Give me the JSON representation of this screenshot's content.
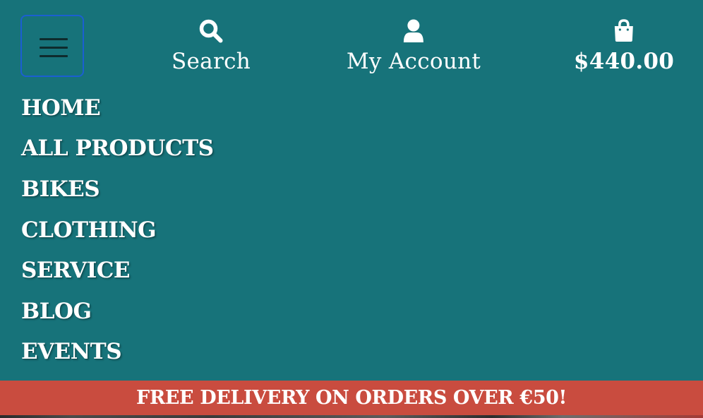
{
  "header": {
    "menu_toggle": {
      "icon": "hamburger-icon"
    },
    "search": {
      "label": "Search",
      "icon": "search-icon"
    },
    "account": {
      "label": "My Account",
      "icon": "user-icon"
    },
    "cart": {
      "label": "$440.00",
      "icon": "shopping-bag-icon"
    }
  },
  "nav": {
    "items": [
      {
        "label": "HOME"
      },
      {
        "label": "ALL PRODUCTS"
      },
      {
        "label": "BIKES"
      },
      {
        "label": "CLOTHING"
      },
      {
        "label": "SERVICE"
      },
      {
        "label": "BLOG"
      },
      {
        "label": "EVENTS"
      }
    ]
  },
  "banner": {
    "text": "FREE DELIVERY ON ORDERS OVER €50!"
  },
  "colors": {
    "background": "#17737a",
    "banner": "#c94c3f",
    "toggler_border": "#1b5fd1",
    "text": "#ffffff"
  }
}
